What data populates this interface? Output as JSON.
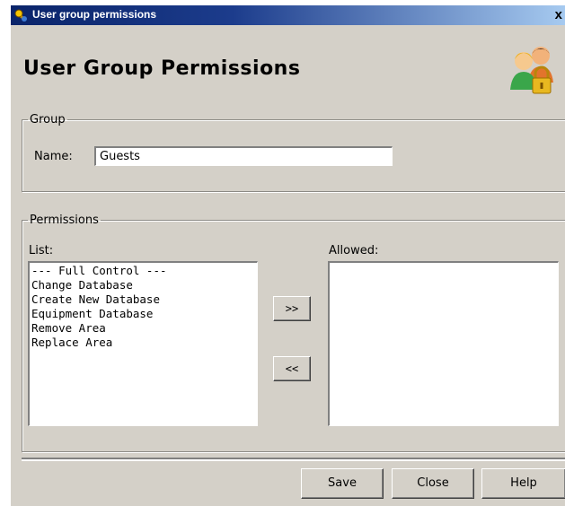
{
  "window": {
    "title": "User group permissions",
    "close_glyph": "x"
  },
  "heading": "User Group Permissions",
  "icons": {
    "title_icon": "app-key-icon",
    "header_icon": "users-lock-icon"
  },
  "group": {
    "legend": "Group",
    "name_label": "Name:",
    "name_value": "Guests"
  },
  "permissions": {
    "legend": "Permissions",
    "list_label": "List:",
    "allowed_label": "Allowed:",
    "list_items": [
      "--- Full Control ---",
      "Change Database",
      "Create New Database",
      "Equipment Database",
      "Remove Area",
      "Replace Area"
    ],
    "allowed_items": [],
    "add_label": ">>",
    "remove_label": "<<"
  },
  "footer": {
    "save_label": "Save",
    "close_label": "Close",
    "help_label": "Help"
  }
}
